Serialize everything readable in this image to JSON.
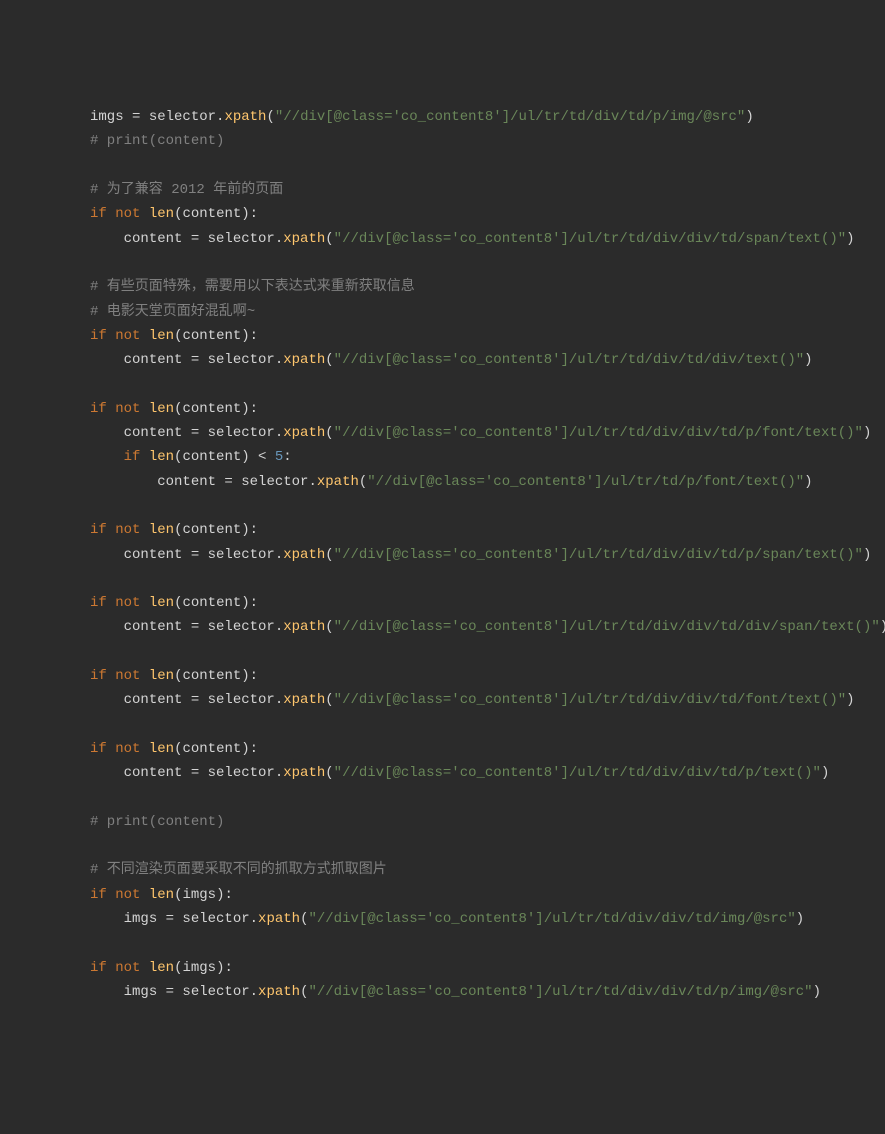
{
  "lines": [
    {
      "indent": 0,
      "tokens": [
        [
          "id",
          "imgs"
        ],
        [
          "op",
          " = selector."
        ],
        [
          "fn",
          "xpath"
        ],
        [
          "op",
          "("
        ],
        [
          "str",
          "\"//div[@class='co_content8']/ul/tr/td/div/td/p/img/@src\""
        ],
        [
          "op",
          ")"
        ]
      ]
    },
    {
      "indent": 0,
      "tokens": [
        [
          "cmt",
          "# print(content)"
        ]
      ]
    },
    {
      "blank": true
    },
    {
      "indent": 0,
      "tokens": [
        [
          "cmt",
          "# 为了兼容 2012 年前的页面"
        ]
      ]
    },
    {
      "indent": 0,
      "tokens": [
        [
          "kw",
          "if"
        ],
        [
          "op",
          " "
        ],
        [
          "kw",
          "not"
        ],
        [
          "op",
          " "
        ],
        [
          "fn",
          "len"
        ],
        [
          "op",
          "(content):"
        ]
      ]
    },
    {
      "indent": 1,
      "tokens": [
        [
          "id",
          "content"
        ],
        [
          "op",
          " = selector."
        ],
        [
          "fn",
          "xpath"
        ],
        [
          "op",
          "("
        ],
        [
          "str",
          "\"//div[@class='co_content8']/ul/tr/td/div/div/td/span/text()\""
        ],
        [
          "op",
          ")"
        ]
      ]
    },
    {
      "blank": true
    },
    {
      "indent": 0,
      "tokens": [
        [
          "cmt",
          "# 有些页面特殊，需要用以下表达式来重新获取信息"
        ]
      ]
    },
    {
      "indent": 0,
      "tokens": [
        [
          "cmt",
          "# 电影天堂页面好混乱啊~"
        ]
      ]
    },
    {
      "indent": 0,
      "tokens": [
        [
          "kw",
          "if"
        ],
        [
          "op",
          " "
        ],
        [
          "kw",
          "not"
        ],
        [
          "op",
          " "
        ],
        [
          "fn",
          "len"
        ],
        [
          "op",
          "(content):"
        ]
      ]
    },
    {
      "indent": 1,
      "tokens": [
        [
          "id",
          "content"
        ],
        [
          "op",
          " = selector."
        ],
        [
          "fn",
          "xpath"
        ],
        [
          "op",
          "("
        ],
        [
          "str",
          "\"//div[@class='co_content8']/ul/tr/td/div/td/div/text()\""
        ],
        [
          "op",
          ")"
        ]
      ]
    },
    {
      "blank": true
    },
    {
      "indent": 0,
      "tokens": [
        [
          "kw",
          "if"
        ],
        [
          "op",
          " "
        ],
        [
          "kw",
          "not"
        ],
        [
          "op",
          " "
        ],
        [
          "fn",
          "len"
        ],
        [
          "op",
          "(content):"
        ]
      ]
    },
    {
      "indent": 1,
      "tokens": [
        [
          "id",
          "content"
        ],
        [
          "op",
          " = selector."
        ],
        [
          "fn",
          "xpath"
        ],
        [
          "op",
          "("
        ],
        [
          "str",
          "\"//div[@class='co_content8']/ul/tr/td/div/div/td/p/font/text()\""
        ],
        [
          "op",
          ")"
        ]
      ]
    },
    {
      "indent": 1,
      "tokens": [
        [
          "kw",
          "if"
        ],
        [
          "op",
          " "
        ],
        [
          "fn",
          "len"
        ],
        [
          "op",
          "(content) < "
        ],
        [
          "num",
          "5"
        ],
        [
          "op",
          ":"
        ]
      ]
    },
    {
      "indent": 2,
      "tokens": [
        [
          "id",
          "content"
        ],
        [
          "op",
          " = selector."
        ],
        [
          "fn",
          "xpath"
        ],
        [
          "op",
          "("
        ],
        [
          "str",
          "\"//div[@class='co_content8']/ul/tr/td/p/font/text()\""
        ],
        [
          "op",
          ")"
        ]
      ]
    },
    {
      "blank": true
    },
    {
      "indent": 0,
      "tokens": [
        [
          "kw",
          "if"
        ],
        [
          "op",
          " "
        ],
        [
          "kw",
          "not"
        ],
        [
          "op",
          " "
        ],
        [
          "fn",
          "len"
        ],
        [
          "op",
          "(content):"
        ]
      ]
    },
    {
      "indent": 1,
      "tokens": [
        [
          "id",
          "content"
        ],
        [
          "op",
          " = selector."
        ],
        [
          "fn",
          "xpath"
        ],
        [
          "op",
          "("
        ],
        [
          "str",
          "\"//div[@class='co_content8']/ul/tr/td/div/div/td/p/span/text()\""
        ],
        [
          "op",
          ")"
        ]
      ]
    },
    {
      "blank": true
    },
    {
      "indent": 0,
      "tokens": [
        [
          "kw",
          "if"
        ],
        [
          "op",
          " "
        ],
        [
          "kw",
          "not"
        ],
        [
          "op",
          " "
        ],
        [
          "fn",
          "len"
        ],
        [
          "op",
          "(content):"
        ]
      ]
    },
    {
      "indent": 1,
      "tokens": [
        [
          "id",
          "content"
        ],
        [
          "op",
          " = selector."
        ],
        [
          "fn",
          "xpath"
        ],
        [
          "op",
          "("
        ],
        [
          "str",
          "\"//div[@class='co_content8']/ul/tr/td/div/div/td/div/span/text()\""
        ],
        [
          "op",
          ")"
        ]
      ]
    },
    {
      "blank": true
    },
    {
      "indent": 0,
      "tokens": [
        [
          "kw",
          "if"
        ],
        [
          "op",
          " "
        ],
        [
          "kw",
          "not"
        ],
        [
          "op",
          " "
        ],
        [
          "fn",
          "len"
        ],
        [
          "op",
          "(content):"
        ]
      ]
    },
    {
      "indent": 1,
      "tokens": [
        [
          "id",
          "content"
        ],
        [
          "op",
          " = selector."
        ],
        [
          "fn",
          "xpath"
        ],
        [
          "op",
          "("
        ],
        [
          "str",
          "\"//div[@class='co_content8']/ul/tr/td/div/div/td/font/text()\""
        ],
        [
          "op",
          ")"
        ]
      ]
    },
    {
      "blank": true
    },
    {
      "indent": 0,
      "tokens": [
        [
          "kw",
          "if"
        ],
        [
          "op",
          " "
        ],
        [
          "kw",
          "not"
        ],
        [
          "op",
          " "
        ],
        [
          "fn",
          "len"
        ],
        [
          "op",
          "(content):"
        ]
      ]
    },
    {
      "indent": 1,
      "tokens": [
        [
          "id",
          "content"
        ],
        [
          "op",
          " = selector."
        ],
        [
          "fn",
          "xpath"
        ],
        [
          "op",
          "("
        ],
        [
          "str",
          "\"//div[@class='co_content8']/ul/tr/td/div/div/td/p/text()\""
        ],
        [
          "op",
          ")"
        ]
      ]
    },
    {
      "blank": true
    },
    {
      "indent": 0,
      "tokens": [
        [
          "cmt",
          "# print(content)"
        ]
      ]
    },
    {
      "blank": true
    },
    {
      "indent": 0,
      "tokens": [
        [
          "cmt",
          "# 不同渲染页面要采取不同的抓取方式抓取图片"
        ]
      ]
    },
    {
      "indent": 0,
      "tokens": [
        [
          "kw",
          "if"
        ],
        [
          "op",
          " "
        ],
        [
          "kw",
          "not"
        ],
        [
          "op",
          " "
        ],
        [
          "fn",
          "len"
        ],
        [
          "op",
          "(imgs):"
        ]
      ]
    },
    {
      "indent": 1,
      "tokens": [
        [
          "id",
          "imgs"
        ],
        [
          "op",
          " = selector."
        ],
        [
          "fn",
          "xpath"
        ],
        [
          "op",
          "("
        ],
        [
          "str",
          "\"//div[@class='co_content8']/ul/tr/td/div/div/td/img/@src\""
        ],
        [
          "op",
          ")"
        ]
      ]
    },
    {
      "blank": true
    },
    {
      "indent": 0,
      "tokens": [
        [
          "kw",
          "if"
        ],
        [
          "op",
          " "
        ],
        [
          "kw",
          "not"
        ],
        [
          "op",
          " "
        ],
        [
          "fn",
          "len"
        ],
        [
          "op",
          "(imgs):"
        ]
      ]
    },
    {
      "indent": 1,
      "tokens": [
        [
          "id",
          "imgs"
        ],
        [
          "op",
          " = selector."
        ],
        [
          "fn",
          "xpath"
        ],
        [
          "op",
          "("
        ],
        [
          "str",
          "\"//div[@class='co_content8']/ul/tr/td/div/div/td/p/img/@src\""
        ],
        [
          "op",
          ")"
        ]
      ]
    }
  ],
  "indent_unit": "    "
}
